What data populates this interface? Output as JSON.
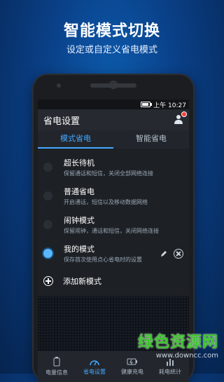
{
  "hero": {
    "title": "智能模式切换",
    "subtitle": "设定或自定义省电模式"
  },
  "status_bar": {
    "time_label": "上午 10:27"
  },
  "app_bar": {
    "title": "省电设置",
    "icon": "user-icon"
  },
  "tabs": [
    {
      "label": "模式省电",
      "active": true
    },
    {
      "label": "智能省电",
      "active": false
    }
  ],
  "modes": [
    {
      "title": "超长待机",
      "desc": "保留通话和短信，关闭全部网络连接",
      "selected": false
    },
    {
      "title": "普通省电",
      "desc": "开启通话，短信以及移动数据网络",
      "selected": false
    },
    {
      "title": "闹钟模式",
      "desc": "保留闹钟，通话和短信，关闭网络连接",
      "selected": false
    },
    {
      "title": "我的模式",
      "desc": "保存首次使用点心省电时的设置",
      "selected": true
    }
  ],
  "add_mode_label": "添加新模式",
  "bottom_nav": [
    {
      "label": "电量信息",
      "icon": "battery-info-icon",
      "active": false
    },
    {
      "label": "省电设置",
      "icon": "speedometer-icon",
      "active": true
    },
    {
      "label": "健康充电",
      "icon": "charging-icon",
      "active": false
    },
    {
      "label": "耗电统计",
      "icon": "bar-chart-icon",
      "active": false
    }
  ],
  "watermark": {
    "text": "绿色资源网",
    "url": "www.downcc.com"
  },
  "colors": {
    "accent": "#43a7ff",
    "selected_radio": "#5ab8ff",
    "watermark": "#3cc42c"
  }
}
